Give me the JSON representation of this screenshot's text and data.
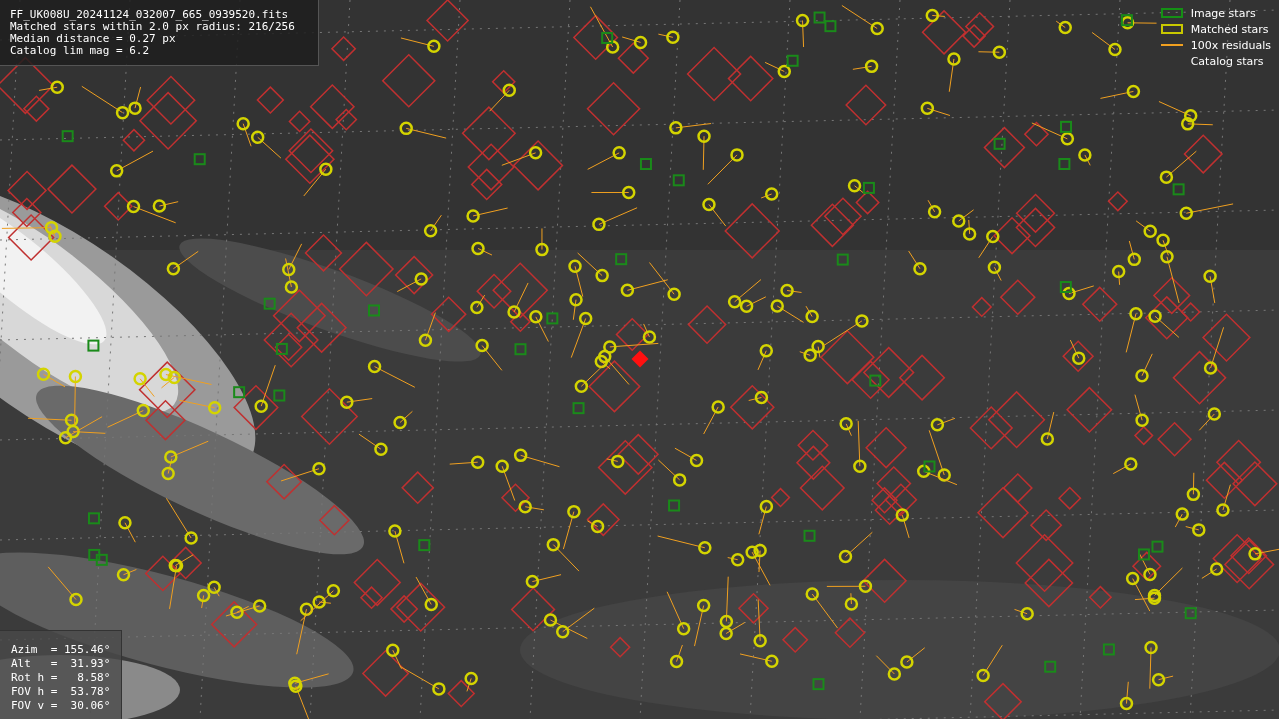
{
  "info_panel": {
    "lines": [
      "FF_UK008U_20241124_032007_665_0939520.fits",
      "Matched stars within 2.0 px radius: 216/256",
      "Median distance = 0.27 px",
      "Catalog lim mag = 6.2"
    ]
  },
  "legend": {
    "items": [
      {
        "label": "Image stars"
      },
      {
        "kind": "matched",
        "label": "Matched stars"
      },
      {
        "kind": "residual",
        "label": "100x residuals"
      },
      {
        "kind": "catalog",
        "label": "Catalog stars"
      }
    ]
  },
  "pointing_panel": {
    "lines": [
      "Azim  = 155.46°",
      "Alt   =  31.93°",
      "Rot h =   8.58°",
      "FOV h =  53.78°",
      "FOV v =  30.06°"
    ]
  }
}
